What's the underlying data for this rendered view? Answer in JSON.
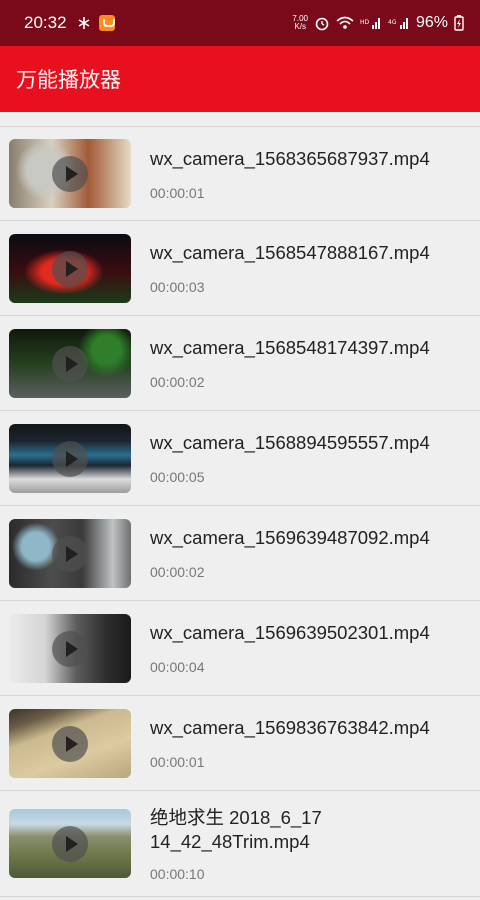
{
  "status": {
    "time": "20:32",
    "speed_top": "7.00",
    "speed_bottom": "K/s",
    "battery": "96%"
  },
  "app": {
    "title": "万能播放器"
  },
  "videos": [
    {
      "name": "wx_camera_1568365687937.mp4",
      "duration": "00:00:01"
    },
    {
      "name": "wx_camera_1568547888167.mp4",
      "duration": "00:00:03"
    },
    {
      "name": "wx_camera_1568548174397.mp4",
      "duration": "00:00:02"
    },
    {
      "name": "wx_camera_1568894595557.mp4",
      "duration": "00:00:05"
    },
    {
      "name": "wx_camera_1569639487092.mp4",
      "duration": "00:00:02"
    },
    {
      "name": "wx_camera_1569639502301.mp4",
      "duration": "00:00:04"
    },
    {
      "name": "wx_camera_1569836763842.mp4",
      "duration": "00:00:01"
    },
    {
      "name": "绝地求生  2018_6_17\n14_42_48Trim.mp4",
      "duration": "00:00:10"
    }
  ],
  "colors": {
    "status_bar": "#7a0a1a",
    "app_bar": "#e8101f",
    "background": "#efefef"
  }
}
